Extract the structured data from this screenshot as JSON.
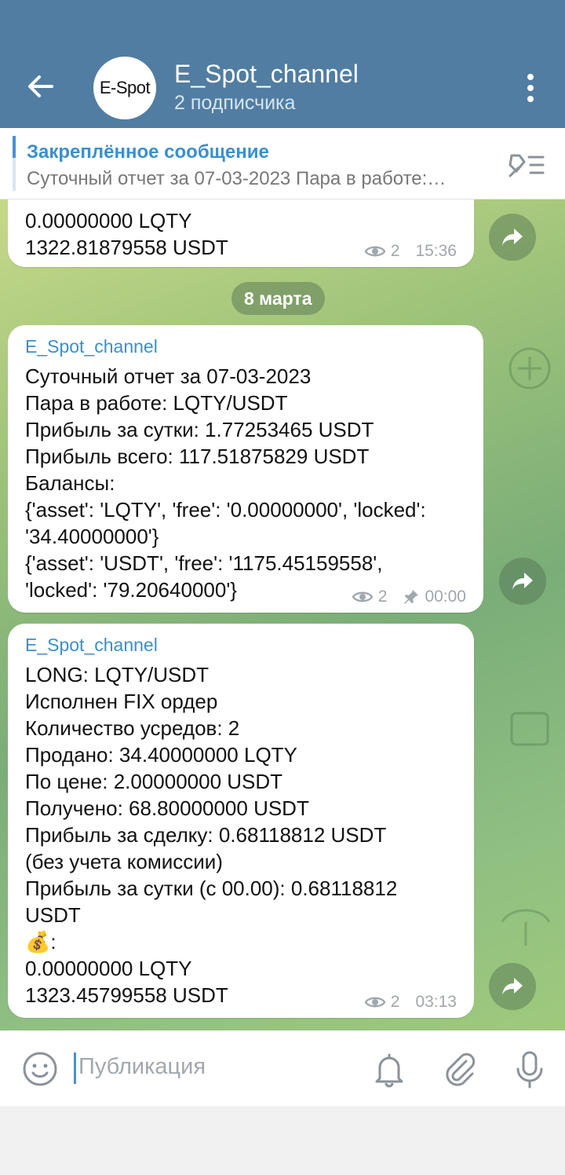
{
  "header": {
    "title": "E_Spot_channel",
    "subtitle": "2 подписчика",
    "avatar_text": "E-Spot"
  },
  "pinned": {
    "title": "Закреплённое сообщение",
    "text": "Суточный отчет за 07-03-2023 Пара в работе:…"
  },
  "messages": [
    {
      "text": "0.00000000 LQTY\n1322.81879558 USDT",
      "views": "2",
      "time": "15:36"
    },
    {
      "sender": "E_Spot_channel",
      "text": "Суточный отчет за 07-03-2023\nПара в работе: LQTY/USDT\nПрибыль за сутки: 1.77253465 USDT\nПрибыль всего: 117.51875829 USDT\nБалансы:\n{'asset': 'LQTY', 'free': '0.00000000', 'locked':\n'34.40000000'}\n{'asset': 'USDT', 'free': '1175.45159558',\n'locked': '79.20640000'}",
      "views": "2",
      "time": "00:00"
    },
    {
      "sender": "E_Spot_channel",
      "text": "LONG: LQTY/USDT\nИсполнен FIX ордер\nКоличество усредов: 2\nПродано: 34.40000000 LQTY\nПо цене: 2.00000000 USDT\nПолучено: 68.80000000 USDT\nПрибыль за сделку: 0.68118812 USDT\n(без учета комиссии)\nПрибыль за сутки (с 00.00): 0.68118812\nUSDT\n💰:\n0.00000000 LQTY\n1323.45799558 USDT",
      "views": "2",
      "time": "03:13"
    }
  ],
  "date_separator": "8 марта",
  "input": {
    "placeholder": "Публикация"
  },
  "colors": {
    "header": "#517da2",
    "accent": "#3a8fd0"
  }
}
